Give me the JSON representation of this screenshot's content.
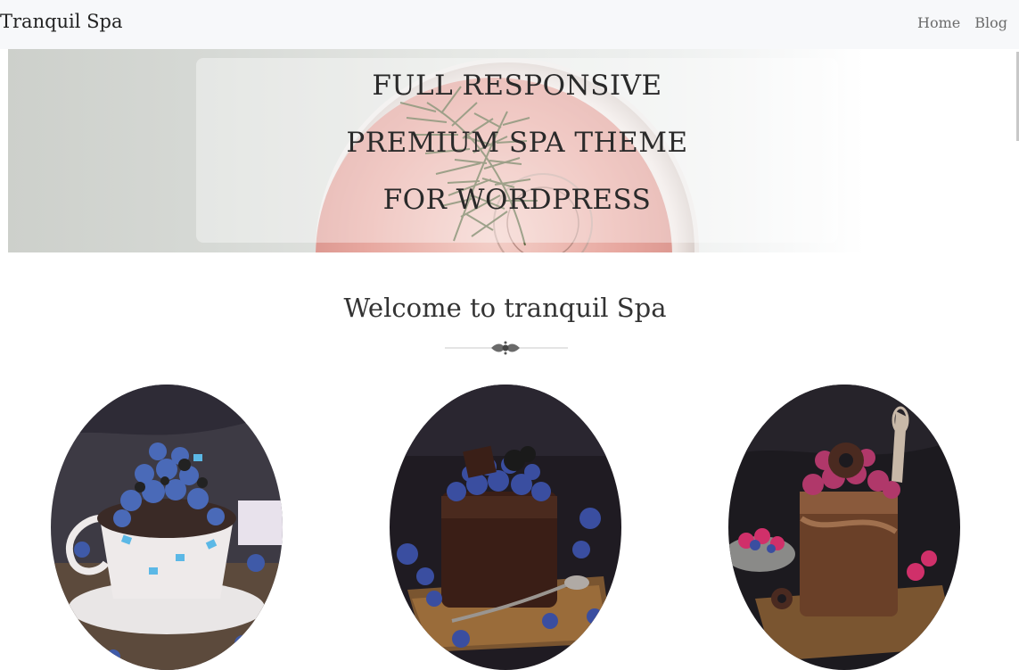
{
  "navbar": {
    "brand": "Tranquil Spa",
    "links": [
      {
        "label": "Home"
      },
      {
        "label": "Blog"
      }
    ]
  },
  "hero": {
    "lines": [
      "FULL RESPONSIVE",
      "PREMIUM SPA THEME",
      "FOR WORDPRESS"
    ]
  },
  "welcome": {
    "title": "Welcome to tranquil Spa"
  },
  "gallery": {
    "items": [
      {
        "subject": "blueberry-cup-cake-image"
      },
      {
        "subject": "chocolate-blueberry-pudding-image"
      },
      {
        "subject": "raspberry-chocolate-parfait-image"
      }
    ]
  },
  "colors": {
    "navbar_bg": "#f7f8fa",
    "text": "#2b2b2b",
    "nav_link": "#6b6b6b"
  }
}
